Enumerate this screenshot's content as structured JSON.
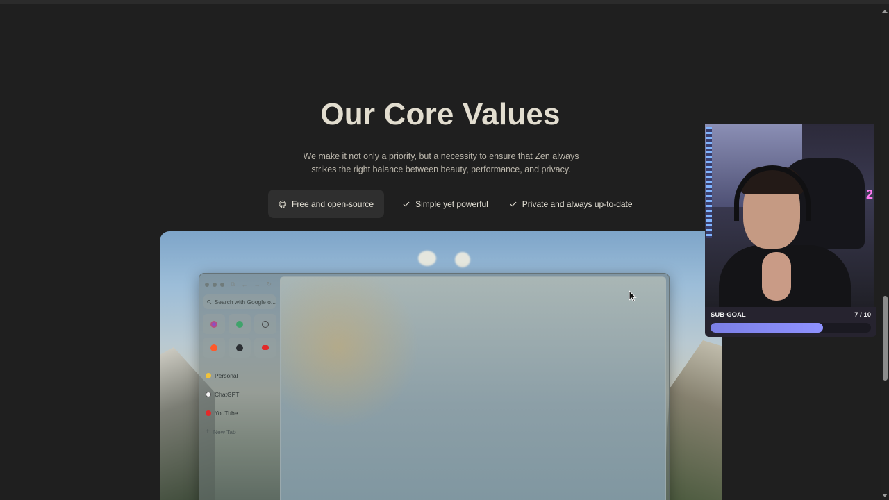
{
  "section": {
    "title": "Our Core Values",
    "subtitle_line1": "We make it not only a priority, but a necessity to ensure that Zen always",
    "subtitle_line2": "strikes the right balance between beauty, performance, and privacy."
  },
  "values": [
    {
      "label": "Free and open-source",
      "icon": "github-icon",
      "active": true
    },
    {
      "label": "Simple yet powerful",
      "icon": "check-icon",
      "active": false
    },
    {
      "label": "Private and always up-to-date",
      "icon": "check-icon",
      "active": false
    }
  ],
  "preview": {
    "search_placeholder": "Search with Google o...",
    "essentials": [
      "firefox-icon",
      "shield-icon",
      "circle-icon",
      "reddit-icon",
      "github-icon",
      "youtube-icon"
    ],
    "workspace": "Personal",
    "tabs": [
      "ChatGPT",
      "YouTube"
    ],
    "new_tab": "New Tab"
  },
  "overlay": {
    "subgoal_label": "SUB-GOAL",
    "subgoal_count": "7 / 10",
    "subgoal_progress": 0.7,
    "webcam_badge": "2"
  },
  "colors": {
    "background": "#1f1f1f",
    "title": "#e2ddcf",
    "active_pill": "#2f2f2f",
    "progress_fill": "#8f92ff"
  }
}
